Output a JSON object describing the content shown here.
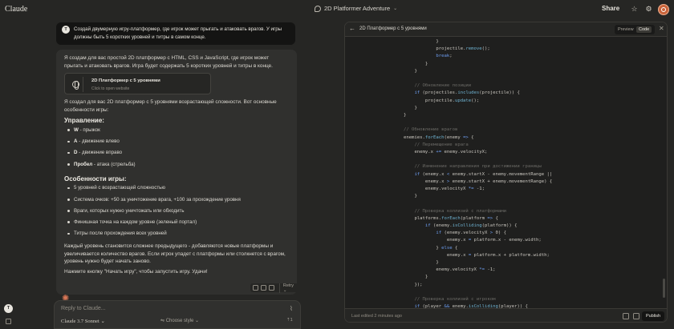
{
  "app": {
    "brand": "Claude",
    "chat_title": "2D Platformer Adventure",
    "share_label": "Share"
  },
  "user_message": {
    "avatar": "T",
    "text": "Создай двумерную игру-платформер, где игрок может прыгать и атаковать врагов. У игры должны быть 5 коротких уровней и титры в самом конце."
  },
  "assistant": {
    "intro": "Я создам для вас простой 2D платформер с HTML, CSS и JavaScript, где игрок может прыгать и атаковать врагов. Игра будет содержать 5 коротких уровней и титры в конце.",
    "artifact": {
      "title": "2D Платформер с 5 уровнями",
      "subtitle": "Click to open website"
    },
    "summary": "Я создал для вас 2D платформер с 5 уровнями возрастающей сложности. Вот основные особенности игры:",
    "controls_heading": "Управление:",
    "controls": [
      {
        "key": "W",
        "desc": " - прыжок"
      },
      {
        "key": "A",
        "desc": " - движение влево"
      },
      {
        "key": "D",
        "desc": " - движение вправо"
      },
      {
        "key": "Пробел",
        "desc": " - атака (стрельба)"
      }
    ],
    "features_heading": "Особенности игры:",
    "features": [
      "5 уровней с возрастающей сложностью",
      "Система очков: +50 за уничтожение врага, +100 за прохождение уровня",
      "Враги, которых нужно уничтожать или обходить",
      "Финишная точка на каждом уровне (зеленый портал)",
      "Титры после прохождения всех уровней"
    ],
    "para1": "Каждый уровень становится сложнее предыдущего - добавляются новые платформы и увеличивается количество врагов. Если игрок упадет с платформы или столкнется с врагом, уровень нужно будет начать заново.",
    "para2": "Нажмите кнопку \"Начать игру\", чтобы запустить игру. Удачи!",
    "retry_label": "Retry"
  },
  "composer": {
    "placeholder": "Reply to Claude...",
    "model": "Claude 3.7 Sonnet",
    "style": "Choose style",
    "count": "1"
  },
  "sidebar": {
    "avatar": "T"
  },
  "panel": {
    "title": "2D Платформер с 5 уровнями",
    "preview_label": "Preview",
    "code_label": "Code",
    "edited": "Last edited 2 minutes ago",
    "publish_label": "Publish"
  },
  "code_lines": [
    {
      "indent": 20,
      "html": "<span class='p'>}</span>"
    },
    {
      "indent": 20,
      "html": "<span class='p'>projectile.</span><span class='f'>remove</span><span class='p'>();</span>"
    },
    {
      "indent": 20,
      "html": "<span class='k'>break</span><span class='p'>;</span>"
    },
    {
      "indent": 16,
      "html": "<span class='p'>}</span>"
    },
    {
      "indent": 12,
      "html": "<span class='p'>}</span>"
    },
    {
      "indent": 0,
      "html": ""
    },
    {
      "indent": 12,
      "html": "<span class='c'>// Обновление позиции</span>"
    },
    {
      "indent": 12,
      "html": "<span class='k'>if</span><span class='p'> (projectiles.</span><span class='f'>includes</span><span class='p'>(projectile)) {</span>"
    },
    {
      "indent": 16,
      "html": "<span class='p'>projectile.</span><span class='f'>update</span><span class='p'>();</span>"
    },
    {
      "indent": 12,
      "html": "<span class='p'>}</span>"
    },
    {
      "indent": 8,
      "html": "<span class='p'>}</span>"
    },
    {
      "indent": 0,
      "html": ""
    },
    {
      "indent": 8,
      "html": "<span class='c'>// Обновление врагов</span>"
    },
    {
      "indent": 8,
      "html": "<span class='p'>enemies.</span><span class='f'>forEach</span><span class='p'>(enemy </span><span class='k'>=></span><span class='p'> {</span>"
    },
    {
      "indent": 12,
      "html": "<span class='c'>// Перемещение врага</span>"
    },
    {
      "indent": 12,
      "html": "<span class='p'>enemy.x </span><span class='k'>+=</span><span class='p'> enemy.velocityX;</span>"
    },
    {
      "indent": 0,
      "html": ""
    },
    {
      "indent": 12,
      "html": "<span class='c'>// Изменение направления при достижении границы</span>"
    },
    {
      "indent": 12,
      "html": "<span class='k'>if</span><span class='p'> (enemy.x </span><span class='k'>&lt;</span><span class='p'> enemy.startX - enemy.movementRange ||</span>"
    },
    {
      "indent": 16,
      "html": "<span class='p'>enemy.x </span><span class='k'>&gt;</span><span class='p'> enemy.startX + enemy.movementRange) {</span>"
    },
    {
      "indent": 16,
      "html": "<span class='p'>enemy.velocityX </span><span class='k'>*=</span><span class='p'> -1;</span>"
    },
    {
      "indent": 12,
      "html": "<span class='p'>}</span>"
    },
    {
      "indent": 0,
      "html": ""
    },
    {
      "indent": 12,
      "html": "<span class='c'>// Проверка коллизий с платформами</span>"
    },
    {
      "indent": 12,
      "html": "<span class='p'>platforms.</span><span class='f'>forEach</span><span class='p'>(platform </span><span class='k'>=></span><span class='p'> {</span>"
    },
    {
      "indent": 16,
      "html": "<span class='k'>if</span><span class='p'> (enemy.</span><span class='f'>isColliding</span><span class='p'>(platform)) {</span>"
    },
    {
      "indent": 20,
      "html": "<span class='k'>if</span><span class='p'> (enemy.velocityX </span><span class='k'>&gt;</span><span class='p'> 0) {</span>"
    },
    {
      "indent": 24,
      "html": "<span class='p'>enemy.x </span><span class='k'>=</span><span class='p'> platform.x - enemy.width;</span>"
    },
    {
      "indent": 20,
      "html": "<span class='p'>} </span><span class='k'>else</span><span class='p'> {</span>"
    },
    {
      "indent": 24,
      "html": "<span class='p'>enemy.x </span><span class='k'>=</span><span class='p'> platform.x + platform.width;</span>"
    },
    {
      "indent": 20,
      "html": "<span class='p'>}</span>"
    },
    {
      "indent": 20,
      "html": "<span class='p'>enemy.velocityX </span><span class='k'>*=</span><span class='p'> -1;</span>"
    },
    {
      "indent": 16,
      "html": "<span class='p'>}</span>"
    },
    {
      "indent": 12,
      "html": "<span class='p'>});</span>"
    },
    {
      "indent": 0,
      "html": ""
    },
    {
      "indent": 12,
      "html": "<span class='c'>// Проверка коллизий с игроком</span>"
    },
    {
      "indent": 12,
      "html": "<span class='k'>if</span><span class='p'> (player </span><span class='k'>&amp;&amp;</span><span class='p'> enemy.</span><span class='f'>isColliding</span><span class='p'>(player)) {</span>"
    }
  ]
}
